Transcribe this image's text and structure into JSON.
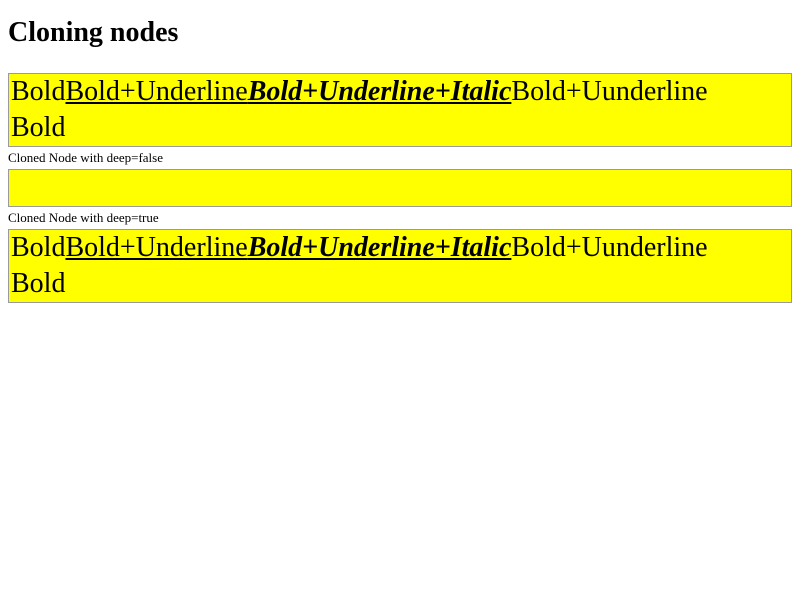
{
  "page": {
    "title": "Cloning nodes",
    "box_background": "#ffff00"
  },
  "original": {
    "seg1": "Bold",
    "seg2": "Bold+Underline",
    "seg3": "Bold+Underline+Italic",
    "seg4": "Bold+Uunderline",
    "seg5": "Bold"
  },
  "shallow_clone": {
    "caption": "Cloned Node with deep=false"
  },
  "deep_clone": {
    "caption": "Cloned Node with deep=true",
    "seg1": "Bold",
    "seg2": "Bold+Underline",
    "seg3": "Bold+Underline+Italic",
    "seg4": "Bold+Uunderline",
    "seg5": "Bold"
  }
}
